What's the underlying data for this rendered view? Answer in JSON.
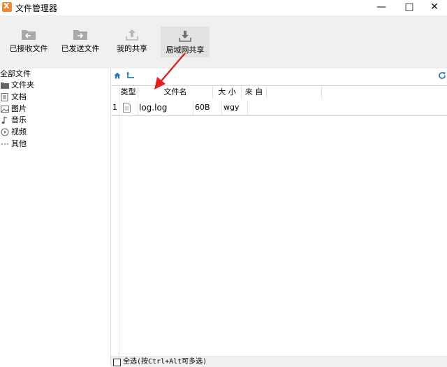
{
  "window": {
    "title": "文件管理器",
    "controls": {
      "minimize": "—",
      "maximize": "□",
      "close": "✕"
    }
  },
  "toolbar": {
    "received": "已接收文件",
    "sent": "已发送文件",
    "my_share": "我的共享",
    "lan_share": "局域网共享"
  },
  "sidebar": {
    "all": "全部文件",
    "items": [
      {
        "label": "文件夹",
        "icon": "folder-icon"
      },
      {
        "label": "文档",
        "icon": "document-icon"
      },
      {
        "label": "图片",
        "icon": "image-icon"
      },
      {
        "label": "音乐",
        "icon": "music-icon"
      },
      {
        "label": "视频",
        "icon": "video-icon"
      },
      {
        "label": "其他",
        "icon": "more-icon"
      }
    ]
  },
  "table": {
    "headers": {
      "type": "类型",
      "name": "文件名",
      "size": "大 小",
      "from": "来 自"
    },
    "rows": [
      {
        "index": "1",
        "name": "log.log",
        "size": "60B",
        "from": "wgy"
      }
    ]
  },
  "footer": {
    "select_all": "全选(按Ctrl+Alt可多选)"
  },
  "colors": {
    "app_icon": "#f08a2e",
    "nav_icons": "#2a7fc0",
    "annotation_arrow": "#e02020"
  }
}
